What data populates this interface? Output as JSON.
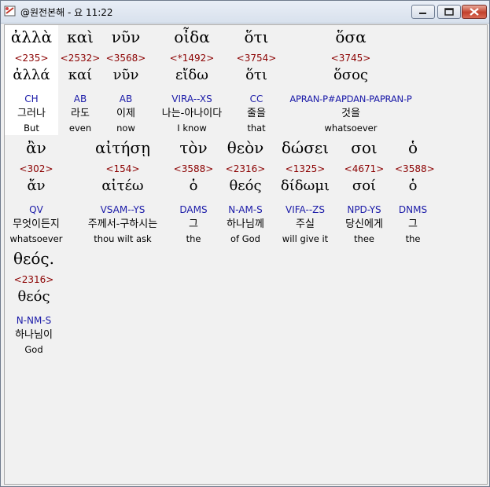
{
  "window": {
    "title": "@원전본해 - 요 11:22",
    "icon": "app-book-icon",
    "controls": [
      "minimize-icon",
      "maximize-icon",
      "close-icon"
    ]
  },
  "words": [
    {
      "greek": "ἀλλὰ",
      "strong": "<235>",
      "lemma": "ἀλλά",
      "code": "CH",
      "korean": "그러나",
      "english": "But"
    },
    {
      "greek": "καὶ",
      "strong": "<2532>",
      "lemma": "καί",
      "code": "AB",
      "korean": "라도",
      "english": "even"
    },
    {
      "greek": "νῦν",
      "strong": "<3568>",
      "lemma": "νῦν",
      "code": "AB",
      "korean": "이제",
      "english": "now"
    },
    {
      "greek": "οἶδα",
      "strong": "<*1492>",
      "lemma": "εἴδω",
      "code": "VIRA--XS",
      "korean": "나는-아나이다",
      "english": "I know"
    },
    {
      "greek": "ὅτι",
      "strong": "<3754>",
      "lemma": "ὅτι",
      "code": "CC",
      "korean": "줄을",
      "english": "that"
    },
    {
      "greek": "ὅσα",
      "strong": "<3745>",
      "lemma": "ὅσος",
      "code": "APRAN-P#APDAN-PAPRAN-P",
      "korean": "것을",
      "english": "whatsoever"
    },
    {
      "greek": "ἂν",
      "strong": "<302>",
      "lemma": "ἄν",
      "code": "QV",
      "korean": "무엇이든지",
      "english": "whatsoever"
    },
    {
      "greek": "αἰτήσῃ",
      "strong": "<154>",
      "lemma": "αἰτέω",
      "code": "VSAM--YS",
      "korean": "주께서-구하시는",
      "english": "thou wilt ask"
    },
    {
      "greek": "τὸν",
      "strong": "<3588>",
      "lemma": "ὁ",
      "code": "DAMS",
      "korean": "그",
      "english": "the"
    },
    {
      "greek": "θεὸν",
      "strong": "<2316>",
      "lemma": "θεός",
      "code": "N-AM-S",
      "korean": "하나님께",
      "english": "of God"
    },
    {
      "greek": "δώσει",
      "strong": "<1325>",
      "lemma": "δίδωμι",
      "code": "VIFA--ZS",
      "korean": "주실",
      "english": "will give it"
    },
    {
      "greek": "σοι",
      "strong": "<4671>",
      "lemma": "σοί",
      "code": "NPD-YS",
      "korean": "당신에게",
      "english": "thee"
    },
    {
      "greek": "ὁ",
      "strong": "<3588>",
      "lemma": "ὁ",
      "code": "DNMS",
      "korean": "그",
      "english": "the"
    },
    {
      "greek": "θεός.",
      "strong": "<2316>",
      "lemma": "θεός",
      "code": "N-NM-S",
      "korean": "하나님이",
      "english": "God"
    }
  ],
  "colors": {
    "strong": "#8b0000",
    "code": "#1a1aa8",
    "background": "#f1f1f1",
    "highlight": "#ffffff"
  }
}
